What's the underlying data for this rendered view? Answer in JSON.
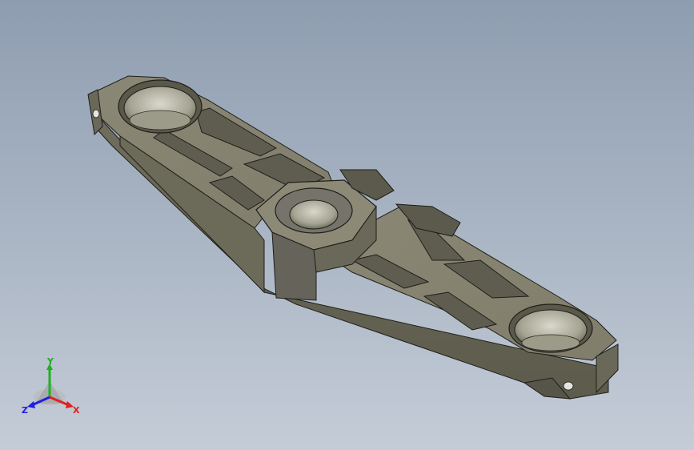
{
  "viewport": {
    "background_top": "#8e9db0",
    "background_bottom": "#c4ccd7"
  },
  "model": {
    "part_color": "#7d7b69",
    "edge_color": "#1e1e1a"
  },
  "triad": {
    "x_label": "X",
    "y_label": "Y",
    "z_label": "Z",
    "x_color": "#e02020",
    "y_color": "#20b020",
    "z_color": "#2020e0"
  }
}
